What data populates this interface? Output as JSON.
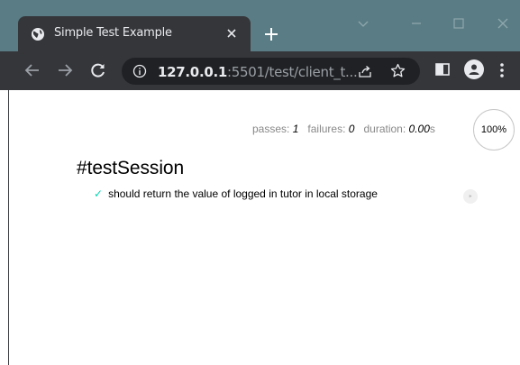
{
  "browser": {
    "tab_title": "Simple Test Example",
    "url_host": "127.0.0.1",
    "url_rest": ":5501/test/client_t...",
    "colors": {
      "frame": "#5a7c84",
      "toolbar": "#35363a",
      "omnibox": "#202124"
    }
  },
  "mocha": {
    "passes_label": "passes:",
    "passes_value": "1",
    "failures_label": "failures:",
    "failures_value": "0",
    "duration_label": "duration:",
    "duration_value": "0.00",
    "duration_unit": "s",
    "progress": "100%",
    "suite_title": "#testSession",
    "tests": [
      {
        "check": "✓",
        "title": "should return the value of logged in tutor in local storage",
        "replay": "‣"
      }
    ],
    "colors": {
      "pass_check": "#00d6b2",
      "stat_text": "#888888"
    }
  }
}
